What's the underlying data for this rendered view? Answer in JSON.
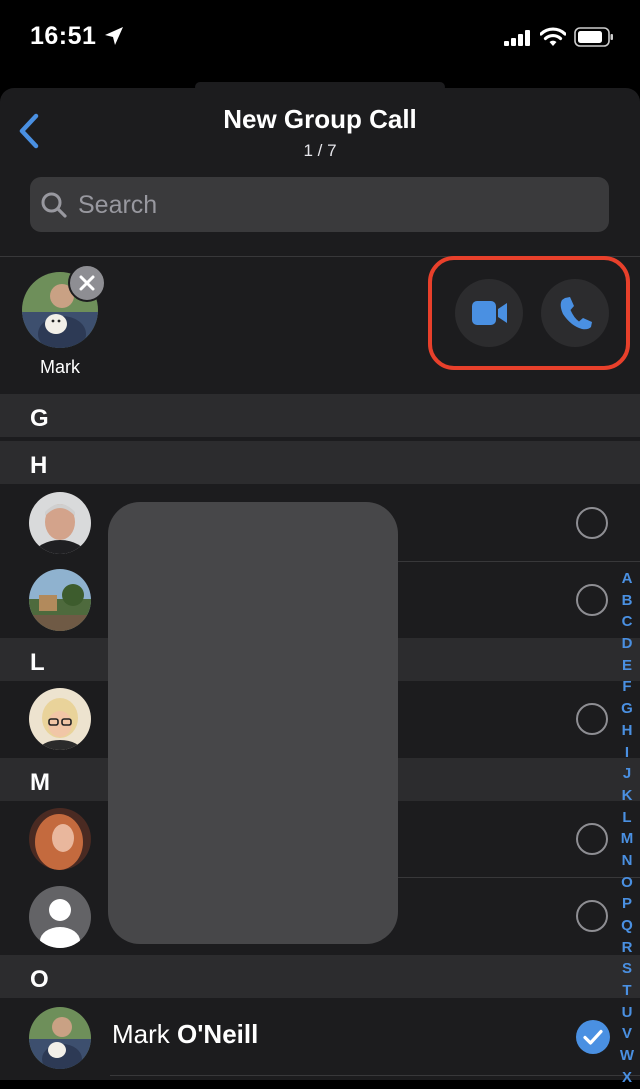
{
  "status_bar": {
    "time": "16:51"
  },
  "header": {
    "title": "New Group Call",
    "subtitle": "1 / 7"
  },
  "search": {
    "placeholder": "Search"
  },
  "selected": {
    "name": "Mark"
  },
  "sections": [
    "G",
    "H",
    "L",
    "M",
    "O"
  ],
  "contact_selected": {
    "first_name": "Mark",
    "last_name": "O'Neill"
  },
  "index_letters": [
    "A",
    "B",
    "C",
    "D",
    "E",
    "F",
    "G",
    "H",
    "I",
    "J",
    "K",
    "L",
    "M",
    "N",
    "O",
    "P",
    "Q",
    "R",
    "S",
    "T",
    "U",
    "V",
    "W",
    "X"
  ],
  "colors": {
    "accent": "#4a90e2",
    "highlight": "#e8402b",
    "background": "#1c1c1e"
  },
  "icons": {
    "back": "chevron-left-icon",
    "video": "video-camera-icon",
    "audio": "phone-icon",
    "remove": "close-icon",
    "check": "checkmark-icon"
  }
}
